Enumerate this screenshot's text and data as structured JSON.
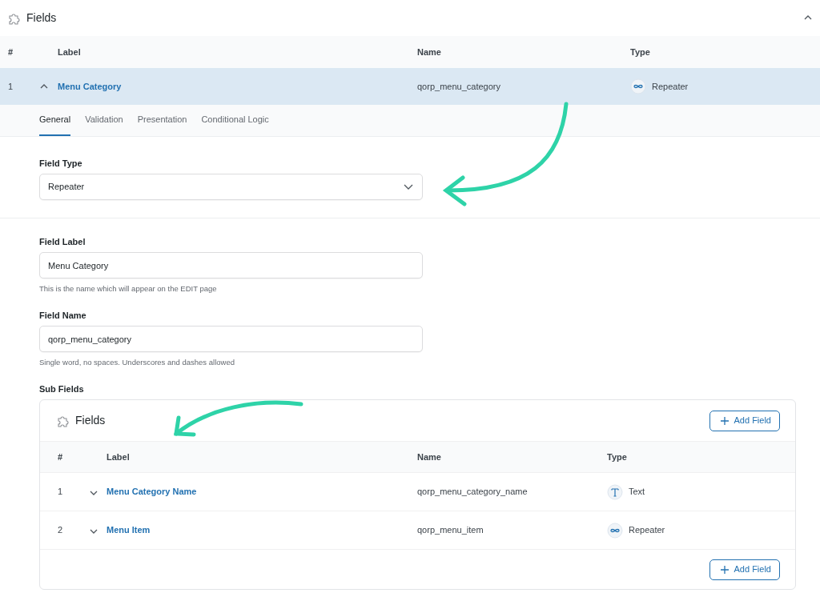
{
  "panel": {
    "title": "Fields",
    "expanded": true
  },
  "table": {
    "columns": [
      "#",
      "Label",
      "Name",
      "Type"
    ],
    "rows": [
      {
        "number": "1",
        "label": "Menu Category",
        "name": "qorp_menu_category",
        "type": "Repeater",
        "kind": "repeater",
        "expanded": true,
        "selected": true
      }
    ]
  },
  "tabs": [
    {
      "label": "General",
      "selected": true
    },
    {
      "label": "Validation",
      "selected": false
    },
    {
      "label": "Presentation",
      "selected": false
    },
    {
      "label": "Conditional Logic",
      "selected": false
    }
  ],
  "field_type": {
    "label": "Field Type",
    "value": "Repeater"
  },
  "field_label": {
    "label": "Field Label",
    "value": "Menu Category",
    "hint": "This is the name which will appear on the EDIT page"
  },
  "field_name": {
    "label": "Field Name",
    "value": "qorp_menu_category",
    "hint": "Single word, no spaces. Underscores and dashes allowed"
  },
  "sub_fields": {
    "label": "Sub Fields",
    "title": "Fields",
    "add_button": "Add Field",
    "columns": [
      "#",
      "Label",
      "Name",
      "Type"
    ],
    "rows": [
      {
        "number": "1",
        "label": "Menu Category Name",
        "name": "qorp_menu_category_name",
        "type": "Text",
        "kind": "text",
        "expanded": false,
        "selected": false
      },
      {
        "number": "2",
        "label": "Menu Item",
        "name": "qorp_menu_item",
        "type": "Repeater",
        "kind": "repeater",
        "expanded": false,
        "selected": false
      }
    ],
    "footer_button": "Add Field"
  }
}
